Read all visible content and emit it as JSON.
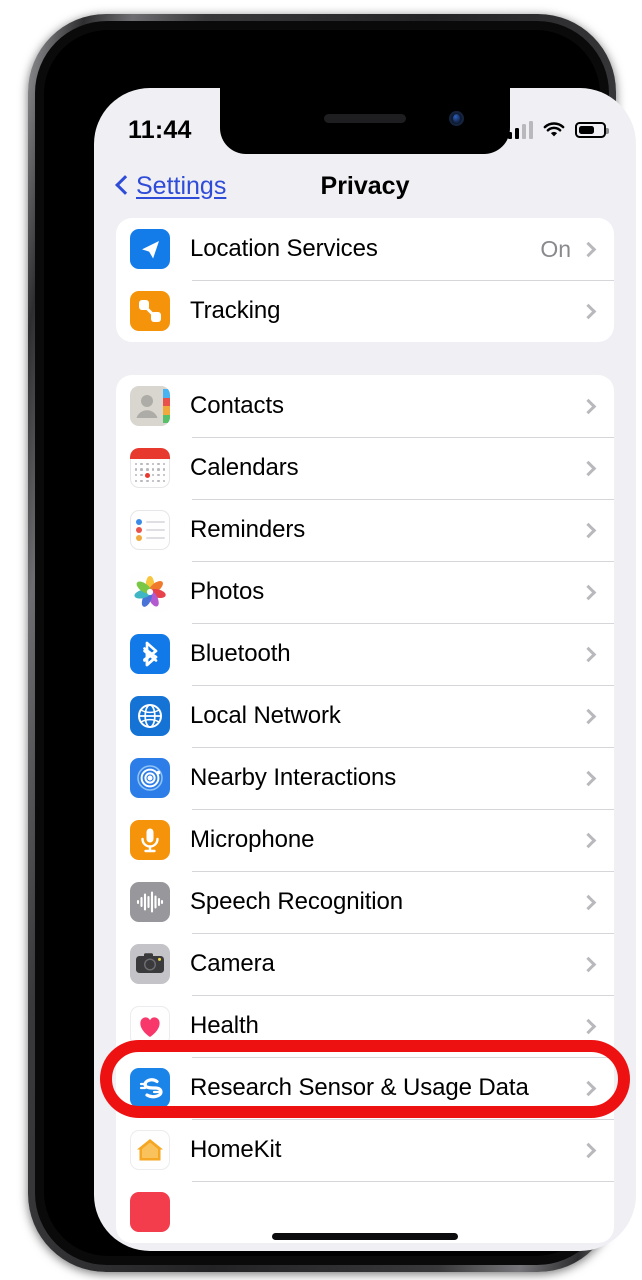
{
  "status_bar": {
    "time": "11:44",
    "signal_icon": "cellular-signal-icon",
    "signal_bars_filled": 2,
    "signal_bars_total": 4,
    "wifi_icon": "wifi-icon",
    "battery_icon": "battery-icon",
    "battery_percent": 65
  },
  "nav": {
    "back_label": "Settings",
    "back_icon": "chevron-left-icon",
    "title": "Privacy"
  },
  "annotation": {
    "shape": "oval",
    "color": "#ee1111",
    "target_row": "Camera"
  },
  "sections": [
    {
      "rows": [
        {
          "label": "Location Services",
          "value": "On",
          "icon": "location-arrow-icon",
          "icon_color": "#137ce8"
        },
        {
          "label": "Tracking",
          "value": "",
          "icon": "tracking-icon",
          "icon_color": "#f5930b"
        }
      ]
    },
    {
      "rows": [
        {
          "label": "Contacts",
          "value": "",
          "icon": "contacts-icon",
          "icon_color": "#d9d6cf"
        },
        {
          "label": "Calendars",
          "value": "",
          "icon": "calendar-icon",
          "icon_color": "#e8392f"
        },
        {
          "label": "Reminders",
          "value": "",
          "icon": "reminders-icon",
          "icon_color": "#ffffff"
        },
        {
          "label": "Photos",
          "value": "",
          "icon": "photos-icon",
          "icon_color": "#ffffff"
        },
        {
          "label": "Bluetooth",
          "value": "",
          "icon": "bluetooth-icon",
          "icon_color": "#1279e8"
        },
        {
          "label": "Local Network",
          "value": "",
          "icon": "globe-icon",
          "icon_color": "#1573d6"
        },
        {
          "label": "Nearby Interactions",
          "value": "",
          "icon": "nearby-interactions-icon",
          "icon_color": "#2d7de8"
        },
        {
          "label": "Microphone",
          "value": "",
          "icon": "microphone-icon",
          "icon_color": "#f5930b"
        },
        {
          "label": "Speech Recognition",
          "value": "",
          "icon": "waveform-icon",
          "icon_color": "#97979c"
        },
        {
          "label": "Camera",
          "value": "",
          "icon": "camera-icon",
          "icon_color": "#c4c4c8"
        },
        {
          "label": "Health",
          "value": "",
          "icon": "heart-icon",
          "icon_color": "#f8386b"
        },
        {
          "label": "Research Sensor & Usage Data",
          "value": "",
          "icon": "research-sensor-icon",
          "icon_color": "#1b84e8"
        },
        {
          "label": "HomeKit",
          "value": "",
          "icon": "house-icon",
          "icon_color": "#f5a623"
        }
      ]
    }
  ]
}
